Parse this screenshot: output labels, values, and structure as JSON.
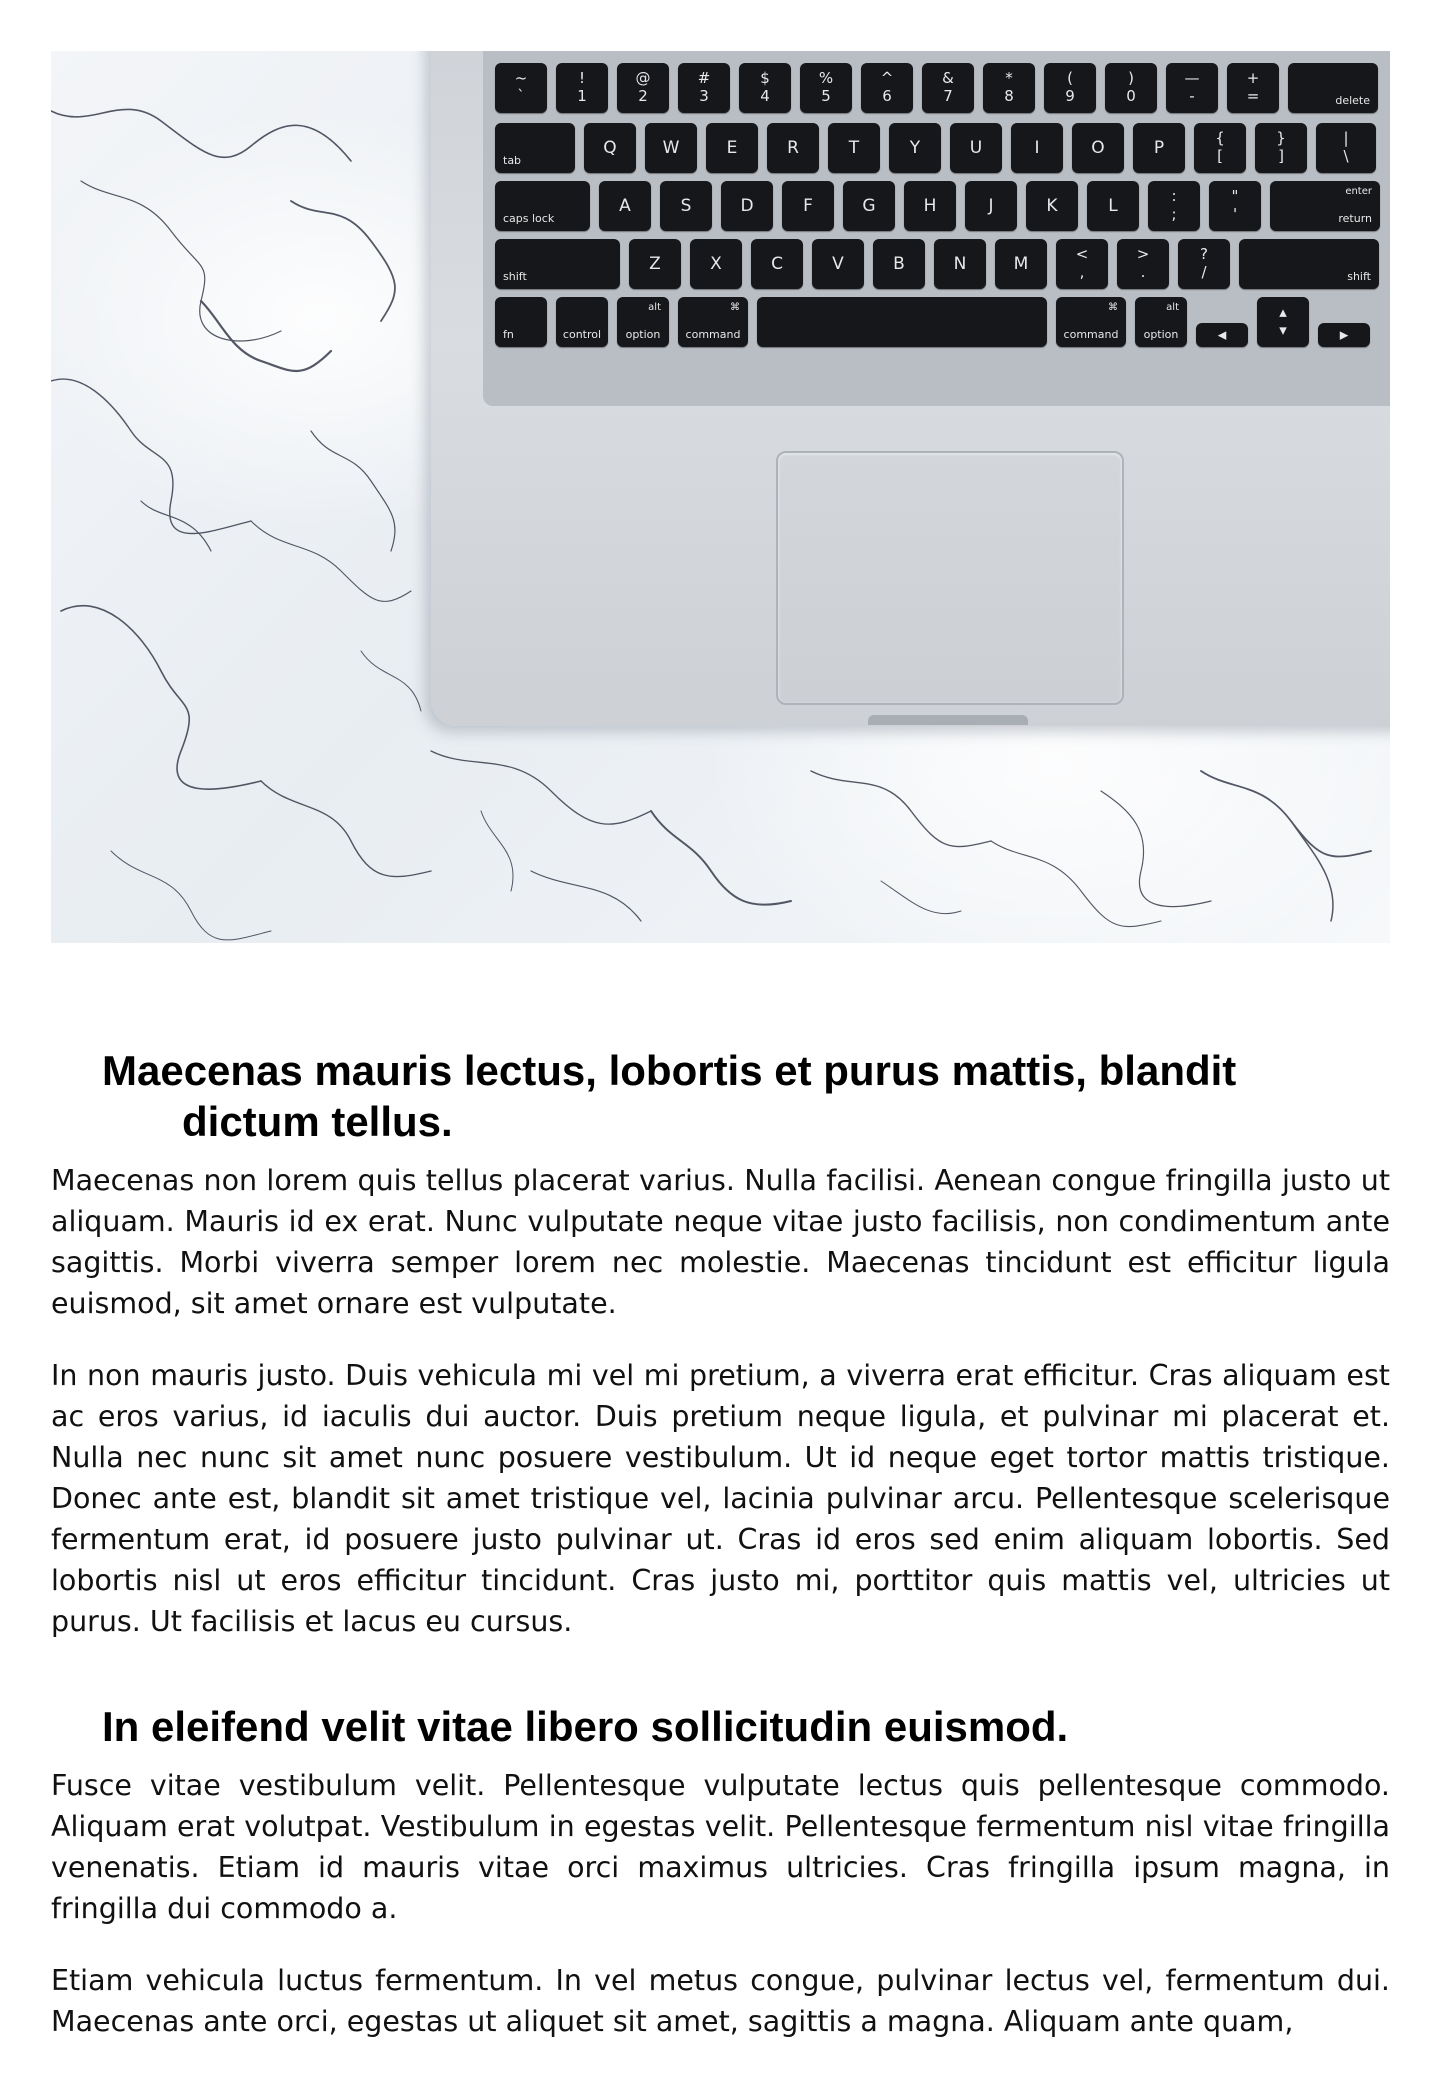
{
  "hero_image": {
    "alt": "",
    "keyboard": {
      "rows": [
        [
          {
            "top": "~",
            "bot": "`"
          },
          {
            "top": "!",
            "bot": "1"
          },
          {
            "top": "@",
            "bot": "2"
          },
          {
            "top": "#",
            "bot": "3"
          },
          {
            "top": "$",
            "bot": "4"
          },
          {
            "top": "%",
            "bot": "5"
          },
          {
            "top": "^",
            "bot": "6"
          },
          {
            "top": "&",
            "bot": "7"
          },
          {
            "top": "*",
            "bot": "8"
          },
          {
            "top": "(",
            "bot": "9"
          },
          {
            "top": ")",
            "bot": "0"
          },
          {
            "top": "—",
            "bot": "-"
          },
          {
            "top": "+",
            "bot": "="
          },
          {
            "small_r": "delete"
          }
        ],
        [
          {
            "small": "tab"
          },
          {
            "mid": "Q"
          },
          {
            "mid": "W"
          },
          {
            "mid": "E"
          },
          {
            "mid": "R"
          },
          {
            "mid": "T"
          },
          {
            "mid": "Y"
          },
          {
            "mid": "U"
          },
          {
            "mid": "I"
          },
          {
            "mid": "O"
          },
          {
            "mid": "P"
          },
          {
            "top": "{",
            "bot": "["
          },
          {
            "top": "}",
            "bot": "]"
          },
          {
            "top": "|",
            "bot": "\\"
          }
        ],
        [
          {
            "small": "caps lock"
          },
          {
            "mid": "A"
          },
          {
            "mid": "S"
          },
          {
            "mid": "D"
          },
          {
            "mid": "F"
          },
          {
            "mid": "G"
          },
          {
            "mid": "H"
          },
          {
            "mid": "J"
          },
          {
            "mid": "K"
          },
          {
            "mid": "L"
          },
          {
            "top": ":",
            "bot": ";"
          },
          {
            "top": "\"",
            "bot": "'"
          },
          {
            "small_r": "return",
            "mod_top": "enter"
          }
        ],
        [
          {
            "small": "shift"
          },
          {
            "mid": "Z"
          },
          {
            "mid": "X"
          },
          {
            "mid": "C"
          },
          {
            "mid": "V"
          },
          {
            "mid": "B"
          },
          {
            "mid": "N"
          },
          {
            "mid": "M"
          },
          {
            "top": "<",
            "bot": ","
          },
          {
            "top": ">",
            "bot": "."
          },
          {
            "top": "?",
            "bot": "/"
          },
          {
            "small_r": "shift"
          }
        ],
        [
          {
            "small": "fn"
          },
          {
            "mod_bot": "control"
          },
          {
            "mod_top": "alt",
            "mod_bot": "option"
          },
          {
            "mod_top": "⌘",
            "mod_bot": "command"
          },
          {
            "space": true
          },
          {
            "mod_top": "⌘",
            "mod_bot": "command"
          },
          {
            "mod_top": "alt",
            "mod_bot": "option"
          },
          {
            "mid": "◂"
          },
          {
            "top": "▴",
            "bot": "▾"
          },
          {
            "mid": "▸"
          }
        ]
      ]
    }
  },
  "sections": [
    {
      "heading_line1": "Maecenas mauris lectus, lobortis et purus mattis, blandit",
      "heading_line2": "dictum tellus.",
      "paragraphs": [
        "Maecenas non lorem quis tellus placerat varius. Nulla facilisi. Aenean congue fringilla justo ut aliquam. Mauris id ex erat. Nunc vulputate neque vitae justo facilisis, non condimentum ante sagittis. Morbi viverra semper lorem nec molestie. Maecenas tincidunt est efficitur ligula euismod, sit amet ornare est vulputate.",
        "In non mauris justo. Duis vehicula mi vel mi pretium, a viverra erat efficitur. Cras aliquam est ac eros varius, id iaculis dui auctor. Duis pretium neque ligula, et pulvinar mi placerat et. Nulla nec nunc sit amet nunc posuere vestibulum. Ut id neque eget tortor mattis tristique. Donec ante est, blandit sit amet tristique vel, lacinia pulvinar arcu. Pellentesque scelerisque fermentum erat, id posuere justo pulvinar ut. Cras id eros sed enim aliquam lobortis. Sed lobortis nisl ut eros efficitur tincidunt. Cras justo mi, porttitor quis mattis vel, ultricies ut purus. Ut facilisis et lacus eu cursus."
      ]
    },
    {
      "heading_line1": "In eleifend velit vitae libero sollicitudin euismod.",
      "heading_line2": "",
      "paragraphs": [
        "Fusce vitae vestibulum velit. Pellentesque vulputate lectus quis pellentesque commodo. Aliquam erat volutpat. Vestibulum in egestas velit. Pellentesque fermentum nisl vitae fringilla venenatis. Etiam id mauris vitae orci maximus ultricies. Cras fringilla ipsum magna, in fringilla dui commodo a.",
        "Etiam vehicula luctus fermentum. In vel metus congue, pulvinar lectus vel, fermentum dui. Maecenas ante orci, egestas ut aliquet sit amet, sagittis a magna. Aliquam ante quam,"
      ]
    }
  ]
}
